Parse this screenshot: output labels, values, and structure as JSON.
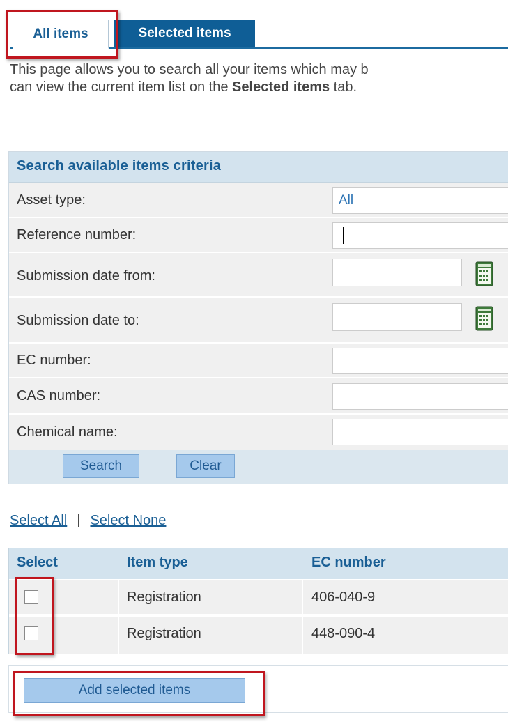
{
  "tabs": {
    "all_items": "All items",
    "selected_items": "Selected items"
  },
  "intro": {
    "line1": "This page allows you to search all your items which may b",
    "line2_prefix": "can view the current item list on the ",
    "line2_bold": "Selected items",
    "line2_suffix": " tab."
  },
  "search": {
    "header": "Search available items criteria",
    "asset_type_label": "Asset type:",
    "asset_type_value": "All",
    "reference_number_label": "Reference number:",
    "reference_number_value": "",
    "submission_from_label": "Submission date from:",
    "submission_from_value": "",
    "submission_to_label": "Submission date to:",
    "submission_to_value": "",
    "ec_number_label": "EC number:",
    "ec_number_value": "",
    "cas_number_label": "CAS number:",
    "cas_number_value": "",
    "chemical_name_label": "Chemical name:",
    "chemical_name_value": "",
    "search_button": "Search",
    "clear_button": "Clear"
  },
  "selection_links": {
    "select_all": "Select All",
    "separator": "|",
    "select_none": "Select None"
  },
  "results": {
    "columns": [
      "Select",
      "Item type",
      "EC number"
    ],
    "rows": [
      {
        "item_type": "Registration",
        "ec_number": "406-040-9",
        "checked": false
      },
      {
        "item_type": "Registration",
        "ec_number": "448-090-4",
        "checked": false
      }
    ]
  },
  "add_button": "Add selected items",
  "icons": {
    "calendar": "calendar-icon"
  },
  "colors": {
    "accent": "#1a5f95",
    "tab_active_bg": "#0f5e96",
    "button_bg": "#a5c9ec",
    "panel_header_bg": "#d3e3ee",
    "highlight": "#c0161f"
  }
}
